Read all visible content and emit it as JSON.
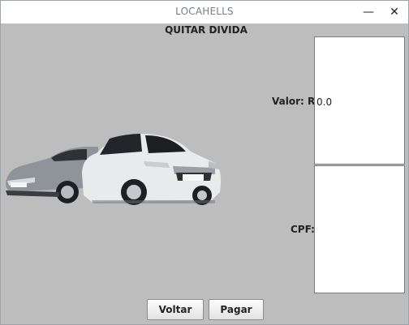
{
  "window": {
    "title": "LOCAHELLS",
    "minimize_glyph": "—",
    "close_glyph": "✕"
  },
  "form": {
    "heading": "QUITAR DIVIDA",
    "valor_label": "Valor: R$",
    "valor_value": "0.0",
    "cpf_label": "CPF:",
    "cpf_value": ""
  },
  "buttons": {
    "voltar": "Voltar",
    "pagar": "Pagar"
  },
  "image": {
    "name": "cars-image"
  },
  "colors": {
    "panel_background": "#bdbdbd",
    "field_background": "#ffffff",
    "title_text": "#7a7f85"
  }
}
